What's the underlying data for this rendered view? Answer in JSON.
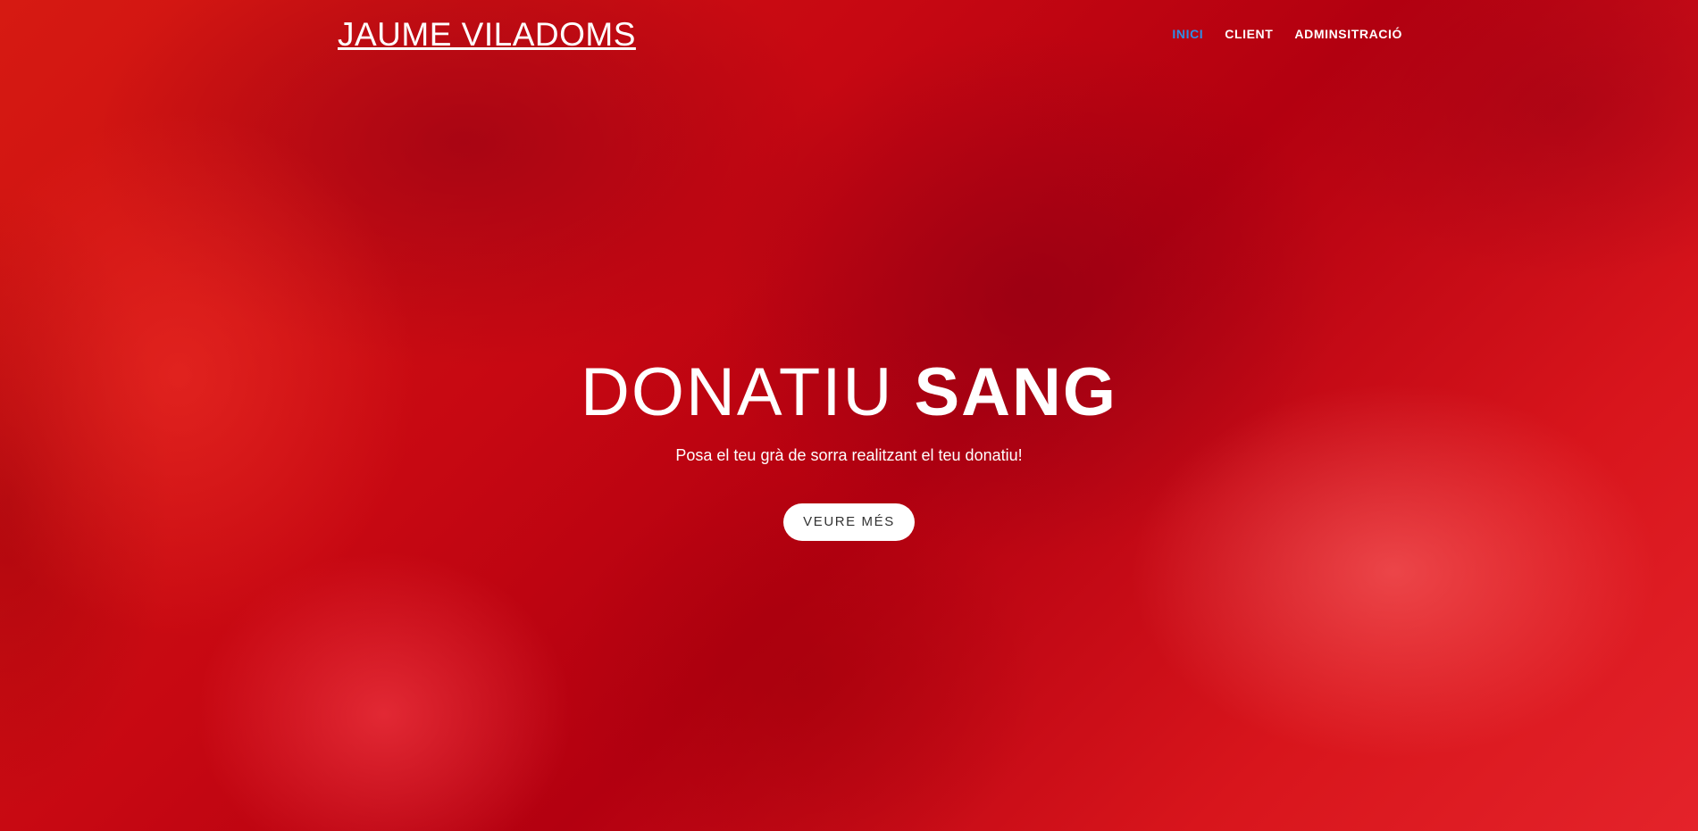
{
  "header": {
    "brand": "JAUME VILADOMS",
    "nav": [
      {
        "label": "INICI",
        "active": true
      },
      {
        "label": "CLIENT",
        "active": false
      },
      {
        "label": "ADMINSITRACIÓ",
        "active": false
      }
    ]
  },
  "hero": {
    "title_light": "DONATIU",
    "title_bold": "SANG",
    "subtitle": "Posa el teu grà de sorra realitzant el teu donatiu!",
    "button_label": "VEURE MÉS"
  },
  "colors": {
    "background": "#c40a10",
    "active_nav": "#2f8ee6",
    "text": "#ffffff",
    "button_bg": "#ffffff",
    "button_text": "#333333"
  }
}
